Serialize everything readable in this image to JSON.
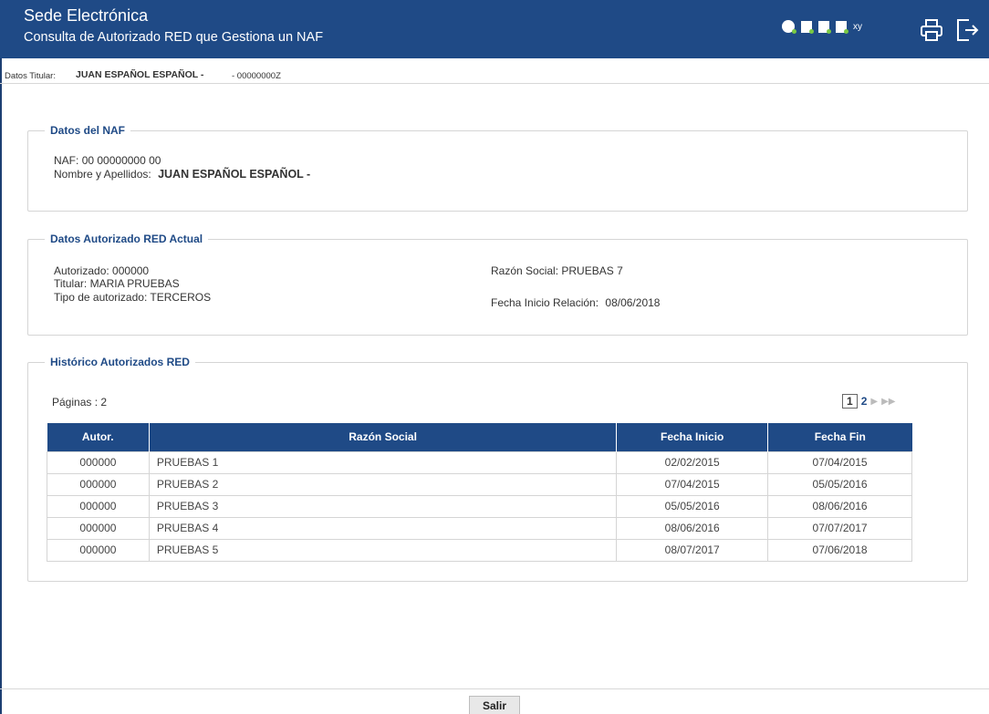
{
  "header": {
    "title": "Sede Electrónica",
    "subtitle": "Consulta de Autorizado RED que Gestiona un NAF",
    "xy_label": "xy"
  },
  "titular": {
    "label": "Datos Titular:",
    "name": "JUAN ESPAÑOL ESPAÑOL -",
    "doc": "- 00000000Z"
  },
  "naf_section": {
    "legend": "Datos del NAF",
    "naf_label": "NAF:",
    "naf_value": "00 00000000 00",
    "name_label": "Nombre y Apellidos:",
    "name_value": "JUAN ESPAÑOL ESPAÑOL -"
  },
  "red_section": {
    "legend": "Datos Autorizado RED Actual",
    "autorizado_label": "Autorizado:",
    "autorizado_value": "000000",
    "titular_label": "Titular:",
    "titular_value": "MARIA PRUEBAS",
    "tipo_label": "Tipo de autorizado:",
    "tipo_value": "TERCEROS",
    "razon_label": "Razón Social:",
    "razon_value": "PRUEBAS 7",
    "fecha_label": "Fecha Inicio Relación:",
    "fecha_value": "08/06/2018"
  },
  "historico": {
    "legend": "Histórico Autorizados RED",
    "pages_text": "Páginas : 2",
    "current_page": "1",
    "next_page": "2",
    "columns": [
      "Autor.",
      "Razón Social",
      "Fecha Inicio",
      "Fecha Fin"
    ],
    "rows": [
      [
        "000000",
        "PRUEBAS 1",
        "02/02/2015",
        "07/04/2015"
      ],
      [
        "000000",
        "PRUEBAS 2",
        "07/04/2015",
        "05/05/2016"
      ],
      [
        "000000",
        "PRUEBAS 3",
        "05/05/2016",
        "08/06/2016"
      ],
      [
        "000000",
        "PRUEBAS 4",
        "08/06/2016",
        "07/07/2017"
      ],
      [
        "000000",
        "PRUEBAS 5",
        "08/07/2017",
        "07/06/2018"
      ]
    ]
  },
  "footer": {
    "salir_label": "Salir"
  },
  "colors": {
    "brand": "#1f4a86",
    "accent_green": "#7ac943"
  }
}
